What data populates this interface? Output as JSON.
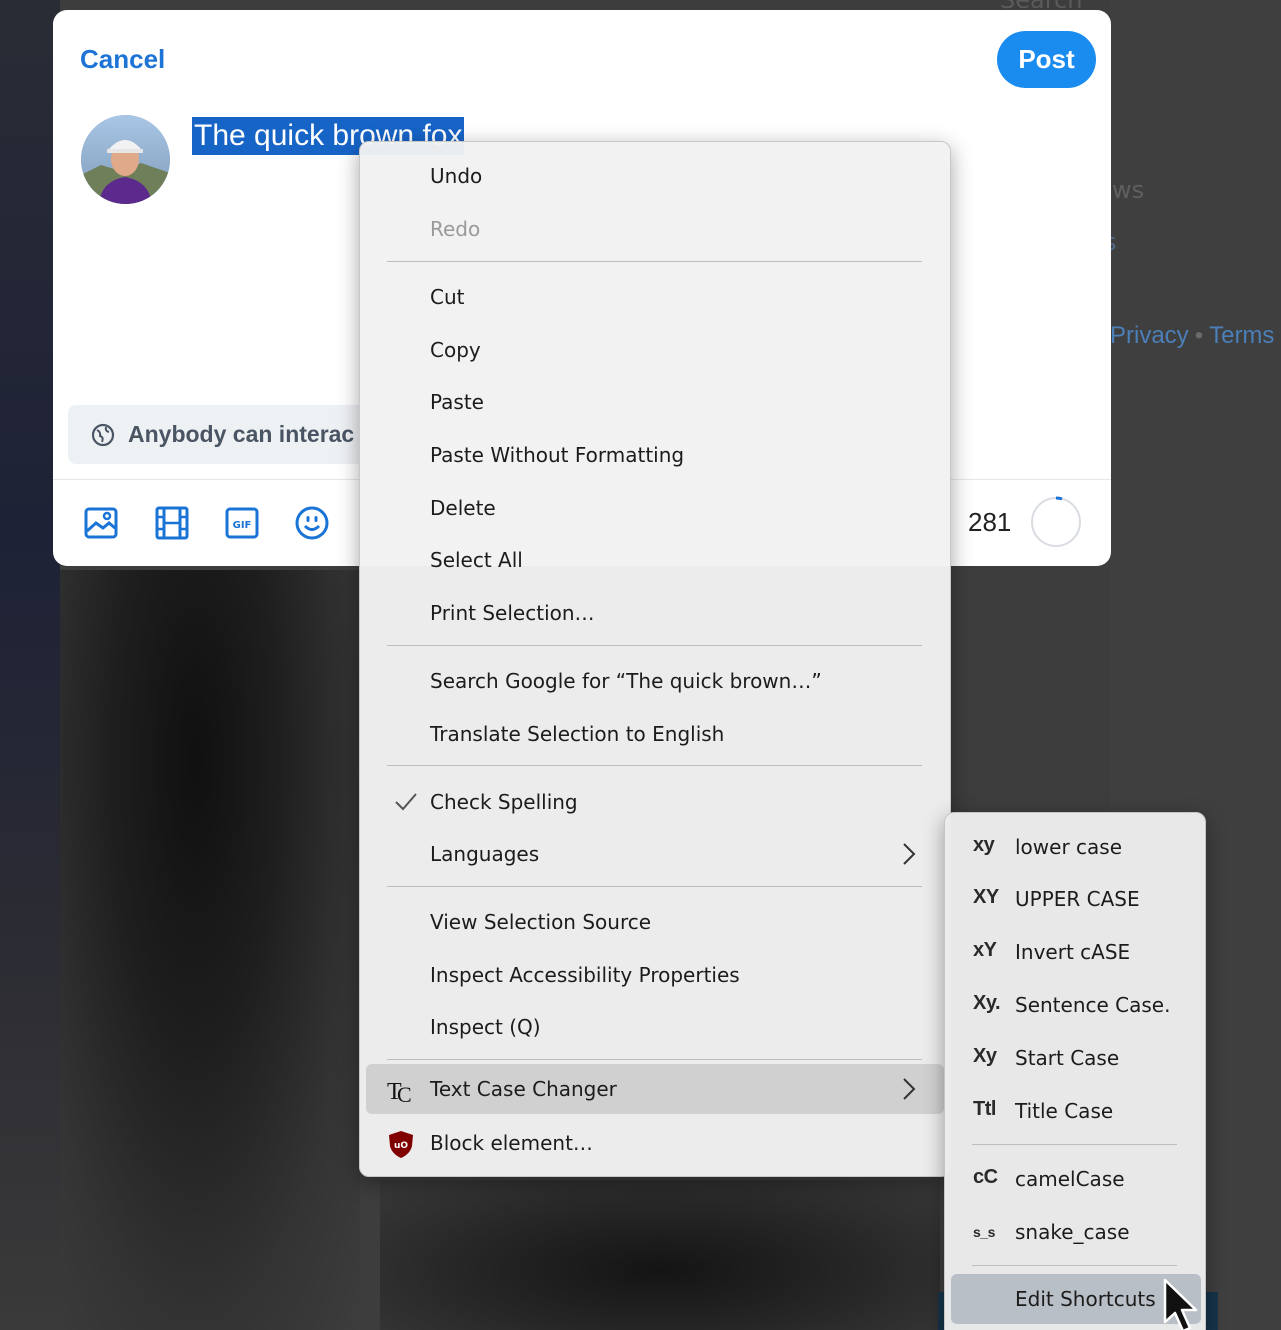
{
  "background": {
    "search_label": "Search",
    "partial_text_1": "ws",
    "partial_text_2": "s",
    "footer_links": [
      "Privacy",
      "Terms"
    ]
  },
  "dialog": {
    "cancel_label": "Cancel",
    "post_label": "Post",
    "post_text": "The quick brown fox",
    "reply_setting": "Anybody can interac",
    "char_remaining": "281",
    "toolbar_icons": [
      "image-icon",
      "video-icon",
      "gif-icon",
      "emoji-icon"
    ],
    "accent_color": "#1a8cf0"
  },
  "context_menu": {
    "items": [
      {
        "label": "Undo",
        "mnemonic": "U",
        "state": "enabled"
      },
      {
        "label": "Redo",
        "mnemonic": "R",
        "state": "disabled"
      },
      {
        "label": "Cut",
        "mnemonic": "t"
      },
      {
        "label": "Copy",
        "mnemonic": "C"
      },
      {
        "label": "Paste",
        "mnemonic": "P"
      },
      {
        "label": "Paste Without Formatting",
        "mnemonic": "m"
      },
      {
        "label": "Delete",
        "mnemonic": "D"
      },
      {
        "label": "Select All",
        "mnemonic": "A"
      },
      {
        "label": "Print Selection…",
        "mnemonic": "r"
      },
      {
        "label": "Search Google for “The quick brown…”",
        "mnemonic": "S"
      },
      {
        "label": "Translate Selection to English",
        "mnemonic": "n"
      },
      {
        "label": "Check Spelling",
        "checked": true
      },
      {
        "label": "Languages",
        "mnemonic": "L",
        "submenu": true
      },
      {
        "label": "View Selection Source",
        "mnemonic": "e"
      },
      {
        "label": "Inspect Accessibility Properties"
      },
      {
        "label": "Inspect (Q)"
      },
      {
        "label": "Text Case Changer",
        "submenu": true,
        "icon": "text-case-changer-icon",
        "highlighted": true
      },
      {
        "label": "Block element…",
        "icon": "ublock-origin-icon"
      }
    ]
  },
  "text_case_submenu": {
    "items": [
      {
        "glyph": "xy",
        "label": "lower case"
      },
      {
        "glyph": "XY",
        "label": "UPPER CASE"
      },
      {
        "glyph": "xY",
        "label": "Invert cASE"
      },
      {
        "glyph": "Xy.",
        "label": "Sentence Case."
      },
      {
        "glyph": "Xy",
        "label": "Start Case"
      },
      {
        "glyph": "Ttl",
        "label": "Title Case"
      },
      {
        "glyph": "cC",
        "label": "camelCase"
      },
      {
        "glyph": "s_s",
        "label": "snake_case"
      },
      {
        "glyph": "",
        "label": "Edit Shortcuts",
        "highlighted": true
      }
    ]
  }
}
